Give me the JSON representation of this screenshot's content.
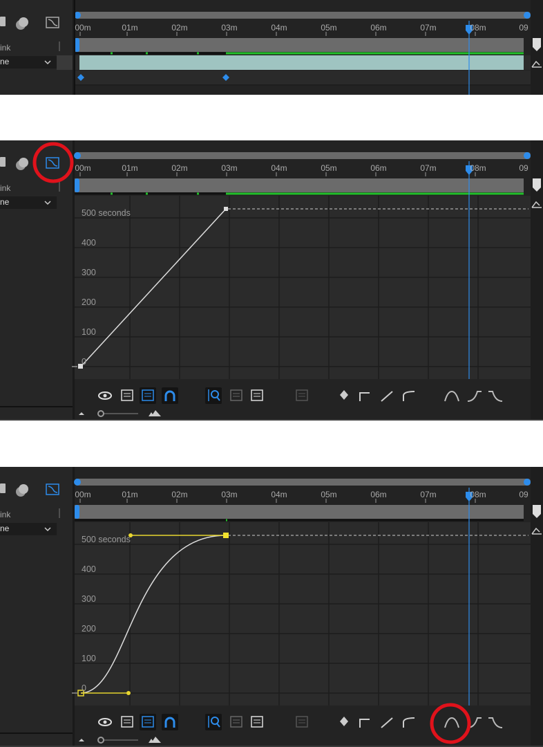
{
  "ruler": {
    "labels": [
      "00m",
      "01m",
      "02m",
      "03m",
      "04m",
      "05m",
      "06m",
      "07m",
      "08m",
      "09"
    ]
  },
  "left_column": {
    "row1_label": "ink",
    "dropdown_value": "ne"
  },
  "graph": {
    "y_labels": [
      "500 seconds",
      "400",
      "300",
      "200",
      "100",
      "0"
    ]
  },
  "colors": {
    "accent": "#2d8ceb",
    "work_area_green": "#22c02a",
    "layer_bar": "#9fc4c1",
    "highlight_circle": "#e0121b",
    "ease_handle": "#e8d630"
  },
  "icons": [
    "list-icon",
    "solo-icon",
    "graph-editor-icon",
    "eye-icon",
    "graph-options-icon",
    "transform-box-icon",
    "snap-icon",
    "auto-zoom-icon",
    "fit-selection-icon",
    "fit-all-icon",
    "separate-dimensions-icon",
    "edit-keyframe-icon",
    "hold-icon",
    "linear-icon",
    "auto-bezier-icon",
    "easy-ease-icon",
    "easy-ease-in-icon",
    "easy-ease-out-icon"
  ]
}
